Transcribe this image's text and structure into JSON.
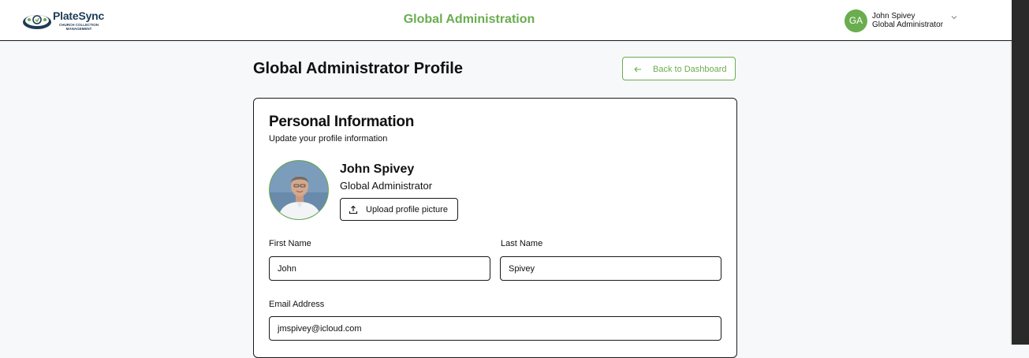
{
  "app": {
    "logo_name": "PlateSync",
    "logo_tagline": "CHURCH COLLECTION MANAGEMENT"
  },
  "header": {
    "title": "Global Administration",
    "user": {
      "initials": "GA",
      "name": "John Spivey",
      "role": "Global Administrator"
    }
  },
  "page": {
    "title": "Global Administrator Profile",
    "back_label": "Back to Dashboard"
  },
  "card": {
    "title": "Personal Information",
    "subtitle": "Update your profile information",
    "profile": {
      "name": "John Spivey",
      "role": "Global Administrator",
      "upload_label": "Upload profile picture"
    },
    "fields": {
      "first_name_label": "First Name",
      "first_name_value": "John",
      "last_name_label": "Last Name",
      "last_name_value": "Spivey",
      "email_label": "Email Address",
      "email_value": "jmspivey@icloud.com"
    }
  },
  "colors": {
    "accent": "#6aad4f",
    "brand_navy": "#1f3b55",
    "background": "#f7f8f9"
  },
  "icons": {
    "chevron": "chevron-down-icon",
    "back": "arrow-left-icon",
    "upload": "upload-icon"
  }
}
